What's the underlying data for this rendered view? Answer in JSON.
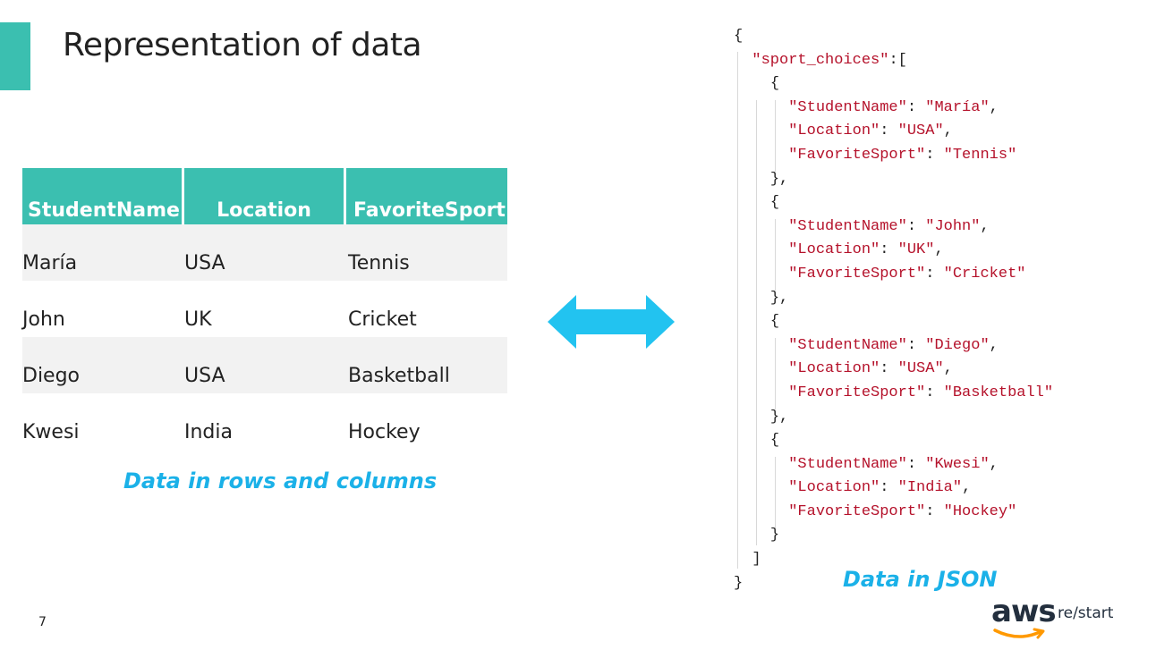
{
  "slide": {
    "title": "Representation of data",
    "page_number": "7"
  },
  "table": {
    "headers": [
      "StudentName",
      "Location",
      "FavoriteSport"
    ],
    "rows": [
      [
        "María",
        "USA",
        "Tennis"
      ],
      [
        "John",
        "UK",
        "Cricket"
      ],
      [
        "Diego",
        "USA",
        "Basketball"
      ],
      [
        "Kwesi",
        "India",
        "Hockey"
      ]
    ],
    "caption": "Data in rows and columns"
  },
  "json_view": {
    "root_key": "sport_choices",
    "key_names": [
      "StudentName",
      "Location",
      "FavoriteSport"
    ],
    "caption": "Data in JSON"
  },
  "logo": {
    "brand": "aws",
    "product": "re/start"
  },
  "colors": {
    "accent": "#3bbfb0",
    "caption": "#1bb1e8",
    "json_string": "#b5122b"
  },
  "icons": [
    "double-arrow-icon",
    "aws-smile-icon"
  ]
}
